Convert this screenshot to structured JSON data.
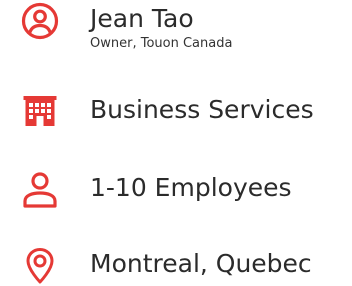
{
  "accent_color": "#e53935",
  "owner": {
    "icon": "account-circle-icon",
    "name": "Jean Tao",
    "title": "Owner, Touon Canada"
  },
  "industry": {
    "icon": "building-icon",
    "label": "Business Services"
  },
  "size": {
    "icon": "person-icon",
    "label": "1-10 Employees"
  },
  "location": {
    "icon": "location-pin-icon",
    "label": "Montreal, Quebec"
  }
}
